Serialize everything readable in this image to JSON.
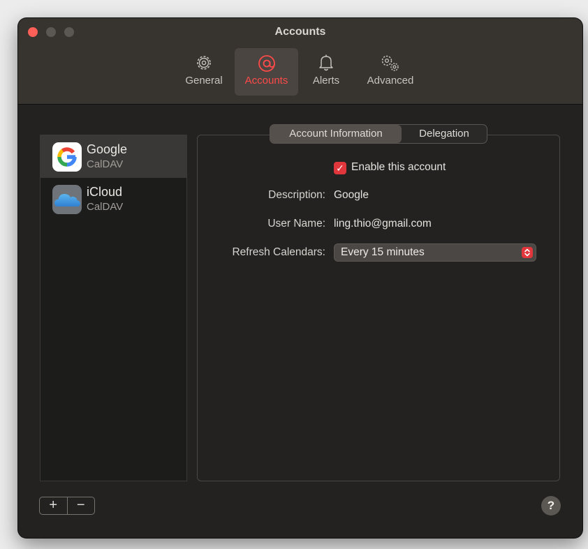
{
  "window": {
    "title": "Accounts"
  },
  "toolbar": {
    "items": [
      {
        "label": "General",
        "icon": "gear-icon",
        "active": false
      },
      {
        "label": "Accounts",
        "icon": "at-sign-icon",
        "active": true
      },
      {
        "label": "Alerts",
        "icon": "bell-icon",
        "active": false
      },
      {
        "label": "Advanced",
        "icon": "gears-icon",
        "active": false
      }
    ]
  },
  "accounts": [
    {
      "name": "Google",
      "type": "CalDAV",
      "logo": "google-logo-icon",
      "selected": true
    },
    {
      "name": "iCloud",
      "type": "CalDAV",
      "logo": "icloud-logo-icon",
      "selected": false
    }
  ],
  "detail": {
    "tabs": [
      {
        "label": "Account Information",
        "selected": true
      },
      {
        "label": "Delegation",
        "selected": false
      }
    ],
    "enable_label": "Enable this account",
    "enable_checked": true,
    "description_label": "Description:",
    "description_value": "Google",
    "username_label": "User Name:",
    "username_value": "ling.thio@gmail.com",
    "refresh_label": "Refresh Calendars:",
    "refresh_value": "Every 15 minutes"
  },
  "footer": {
    "add_label": "+",
    "remove_label": "−",
    "help_label": "?"
  },
  "colors": {
    "accent": "#e0363c",
    "active_tab_text": "#ff4a4a",
    "window_bg": "#232220"
  }
}
